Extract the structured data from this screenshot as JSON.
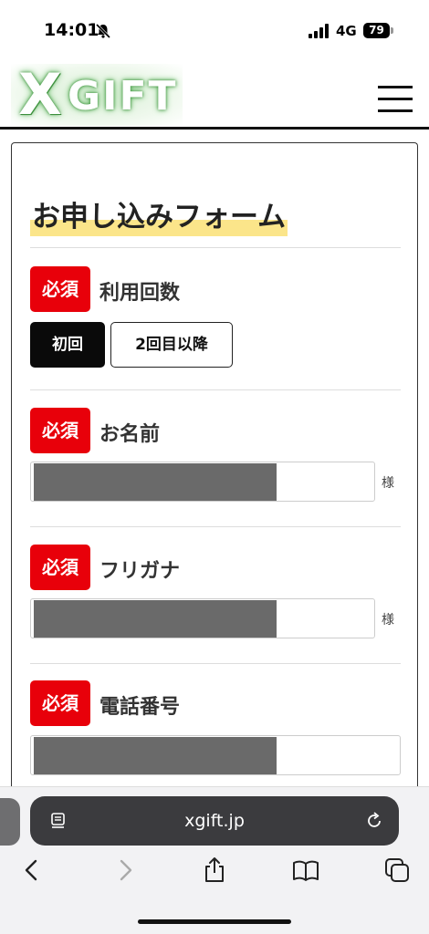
{
  "status_bar": {
    "time": "14:01",
    "network": "4G",
    "battery": "79"
  },
  "site": {
    "logo_x": "X",
    "logo_gift": "GIFT"
  },
  "form": {
    "title": "お申し込みフォーム",
    "required_label": "必須",
    "usage": {
      "label": "利用回数",
      "options": [
        "初回",
        "2回目以降"
      ],
      "selected": "初回"
    },
    "name": {
      "label": "お名前",
      "suffix": "様"
    },
    "furigana": {
      "label": "フリガナ",
      "suffix": "様"
    },
    "phone": {
      "label": "電話番号"
    }
  },
  "browser": {
    "url": "xgift.jp"
  },
  "icons": {
    "status_bell": "bell-slash-icon",
    "menu": "hamburger-menu-icon",
    "url_page": "page-settings-icon",
    "reload": "reload-icon",
    "back": "chevron-left-icon",
    "forward": "chevron-right-icon",
    "share": "share-icon",
    "bookmarks": "book-icon",
    "tabs": "tabs-icon"
  },
  "colors": {
    "required_bg": "#e8000a",
    "title_highlight": "#fbe58a",
    "selected_btn": "#0a0a0a"
  }
}
